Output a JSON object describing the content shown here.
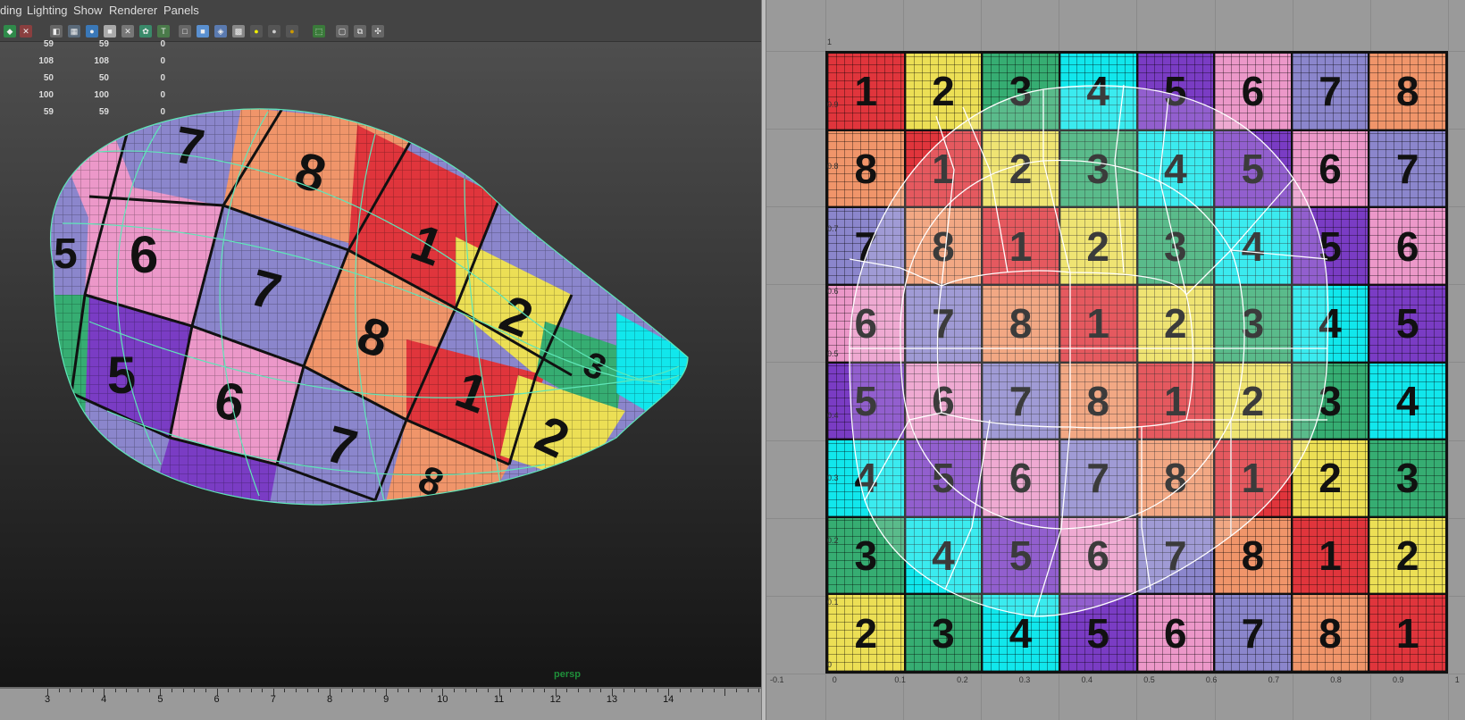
{
  "menubar": {
    "items": [
      "ding",
      "Lighting",
      "Show",
      "Renderer",
      "Panels"
    ]
  },
  "hud": {
    "rows": [
      {
        "a": "59",
        "b": "59",
        "c": "0"
      },
      {
        "a": "108",
        "b": "108",
        "c": "0"
      },
      {
        "a": "50",
        "b": "50",
        "c": "0"
      },
      {
        "a": "100",
        "b": "100",
        "c": "0"
      },
      {
        "a": "59",
        "b": "59",
        "c": "0"
      }
    ]
  },
  "viewport": {
    "camera_label": "persp",
    "patch_numbers": [
      "7",
      "8",
      "6",
      "7",
      "1",
      "8",
      "2",
      "5",
      "6",
      "1",
      "3",
      "7",
      "2",
      "8",
      "5"
    ]
  },
  "timeline": {
    "ticks": [
      "3",
      "4",
      "5",
      "6",
      "7",
      "8",
      "9",
      "10",
      "11",
      "12",
      "13",
      "14"
    ]
  },
  "uv_editor": {
    "grid_rows": [
      [
        "1",
        "2",
        "3",
        "4",
        "5",
        "6",
        "7",
        "8"
      ],
      [
        "8",
        "1",
        "2",
        "3",
        "4",
        "5",
        "6",
        "7"
      ],
      [
        "7",
        "8",
        "1",
        "2",
        "3",
        "4",
        "5",
        "6"
      ],
      [
        "6",
        "7",
        "8",
        "1",
        "2",
        "3",
        "4",
        "5"
      ],
      [
        "5",
        "6",
        "7",
        "8",
        "1",
        "2",
        "3",
        "4"
      ],
      [
        "4",
        "5",
        "6",
        "7",
        "8",
        "1",
        "2",
        "3"
      ],
      [
        "3",
        "4",
        "5",
        "6",
        "7",
        "8",
        "1",
        "2"
      ],
      [
        "2",
        "3",
        "4",
        "5",
        "6",
        "7",
        "8",
        "1"
      ]
    ],
    "colors": {
      "1": "#e0353c",
      "2": "#ecdf55",
      "3": "#36ad72",
      "4": "#11e7ec",
      "5": "#7a3cc4",
      "6": "#ec98c9",
      "7": "#8b86cc",
      "8": "#f0956a"
    },
    "axis_labels_y": [
      "1",
      "0.9",
      "0.8",
      "0.7",
      "0.6",
      "0.5",
      "0.4",
      "0.3",
      "0.2",
      "0.1",
      "0"
    ],
    "axis_labels_x": [
      "-0.1",
      "0",
      "0.1",
      "0.2",
      "0.3",
      "0.4",
      "0.5",
      "0.6",
      "0.7",
      "0.8",
      "0.9",
      "1"
    ]
  }
}
